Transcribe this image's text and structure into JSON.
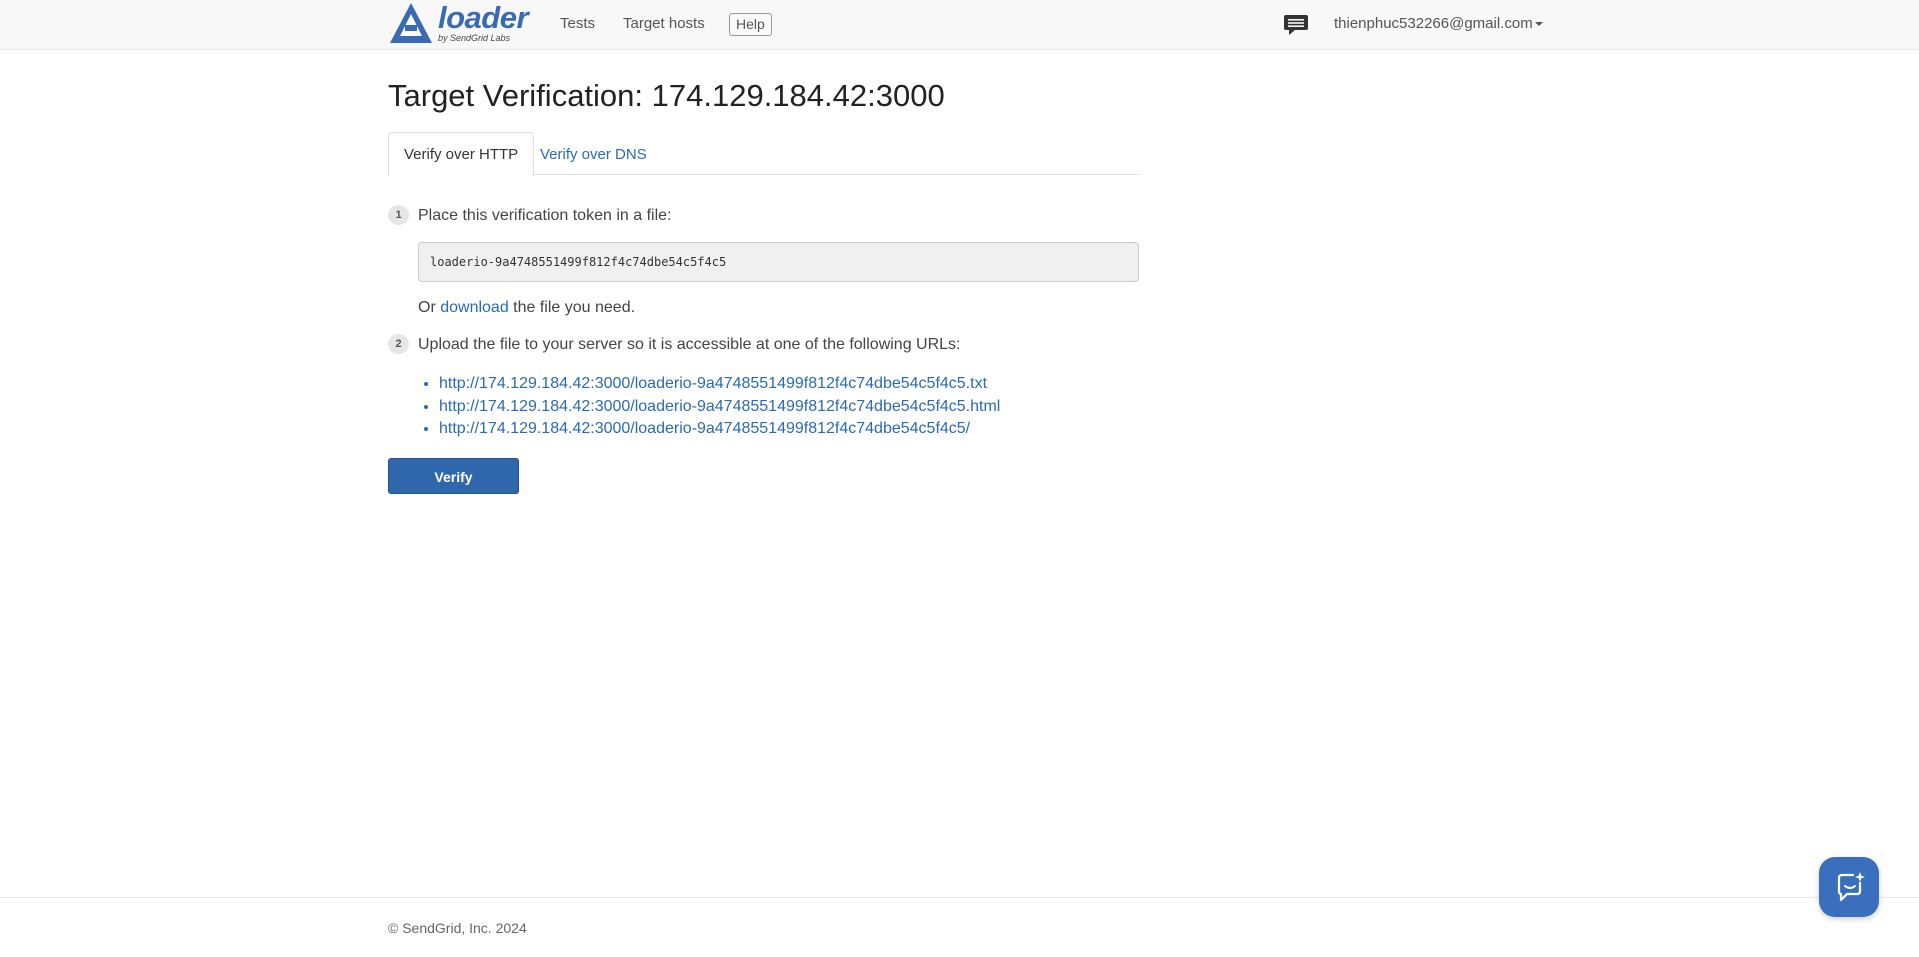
{
  "brand": {
    "name": "loader",
    "tagline": "by SendGrid Labs",
    "color": "#3a6ab3"
  },
  "nav": {
    "tests": "Tests",
    "target_hosts": "Target hosts",
    "help": "Help",
    "chat_icon": "chat-bubble-icon",
    "user_email": "thienphuc532266@gmail.com"
  },
  "page": {
    "title": "Target Verification: 174.129.184.42:3000",
    "tabs": [
      {
        "label": "Verify over HTTP",
        "active": true
      },
      {
        "label": "Verify over DNS",
        "active": false
      }
    ]
  },
  "steps": [
    {
      "number": "1",
      "text": "Place this verification token in a file:"
    },
    {
      "number": "2",
      "text": "Upload the file to your server so it is accessible at one of the following URLs:"
    }
  ],
  "token": "loaderio-9a4748551499f812f4c74dbe54c5f4c5",
  "download_line": {
    "prefix": "Or ",
    "link": "download",
    "suffix": " the file you need."
  },
  "urls": [
    "http://174.129.184.42:3000/loaderio-9a4748551499f812f4c74dbe54c5f4c5.txt",
    "http://174.129.184.42:3000/loaderio-9a4748551499f812f4c74dbe54c5f4c5.html",
    "http://174.129.184.42:3000/loaderio-9a4748551499f812f4c74dbe54c5f4c5/"
  ],
  "verify_button": "Verify",
  "footer": "© SendGrid, Inc. 2024",
  "colors": {
    "link": "#2a6ab5",
    "primary_button": "#2f67ad",
    "help_launcher": "#3a6fbd"
  },
  "help_launcher_icon": "support-chat-icon"
}
